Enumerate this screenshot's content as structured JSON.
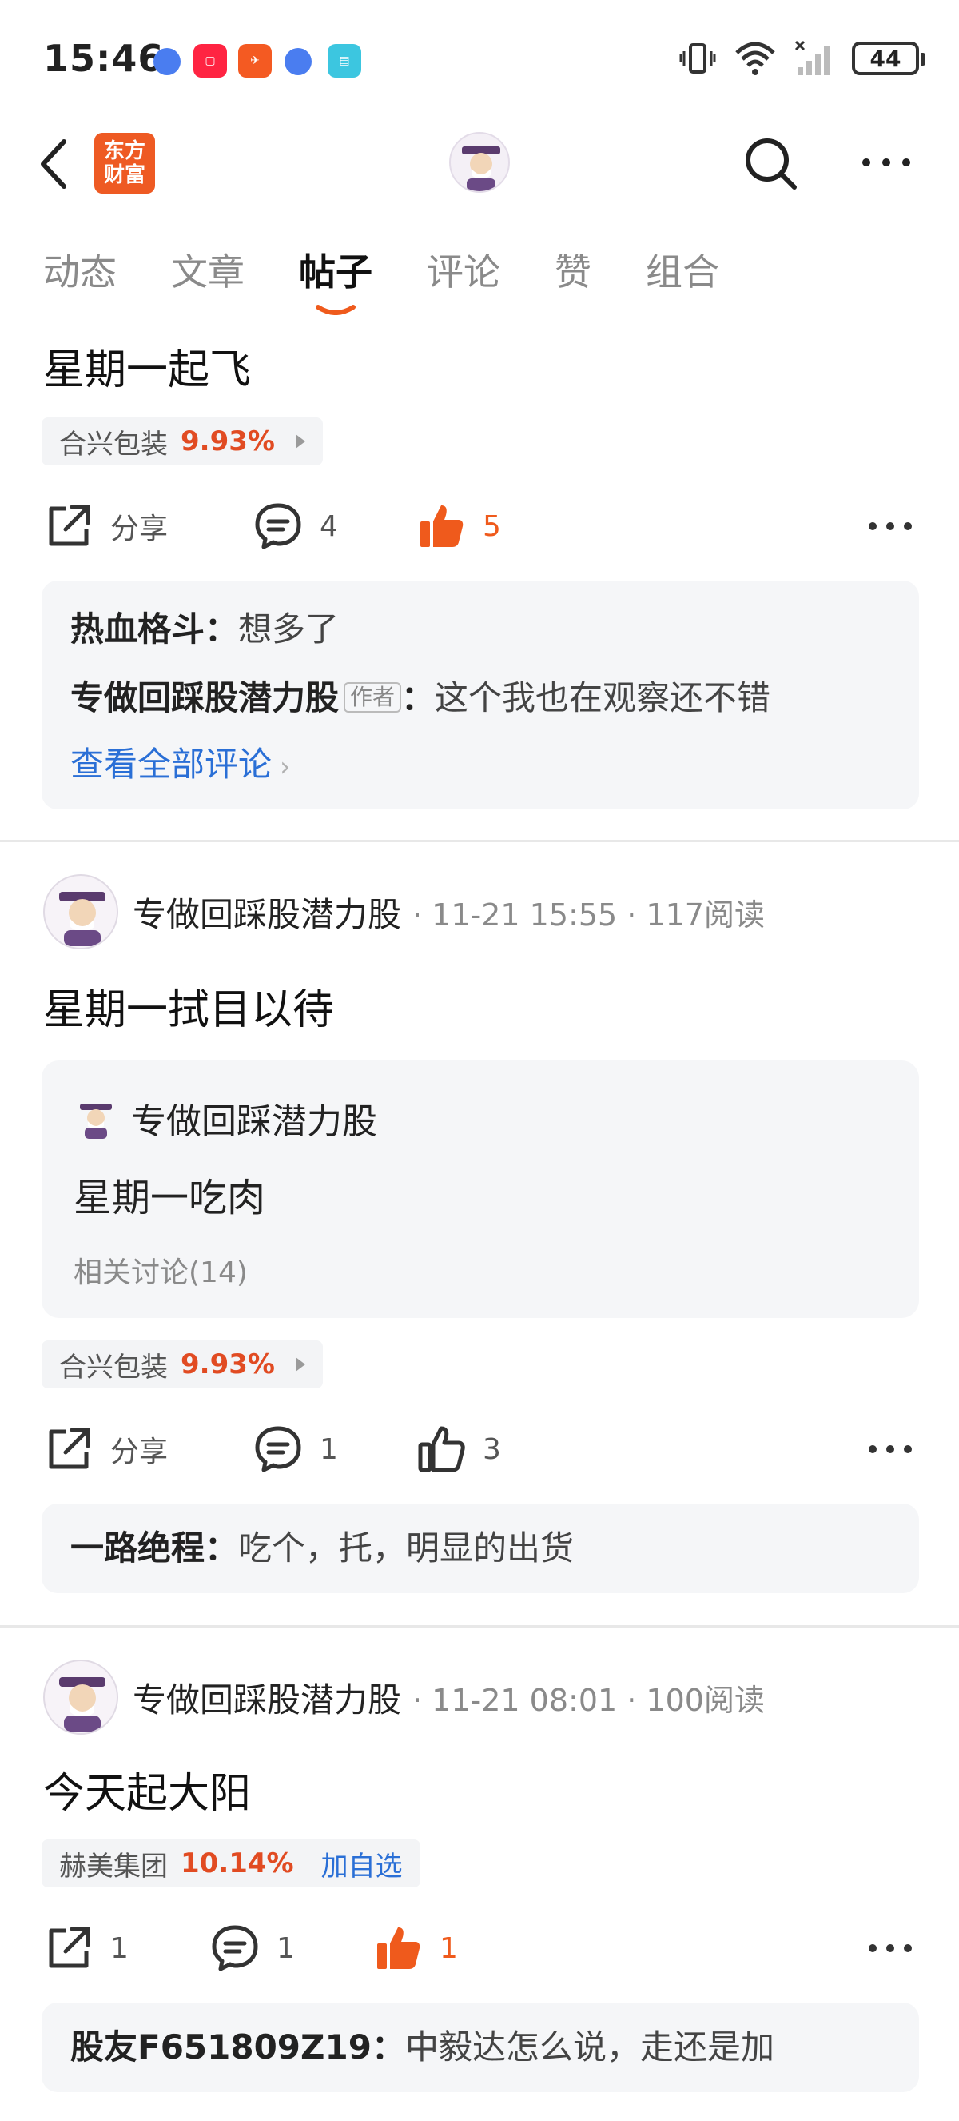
{
  "status_bar": {
    "time": "15:46",
    "battery": "44"
  },
  "header": {
    "brand_line1": "东方",
    "brand_line2": "财富"
  },
  "tabs": [
    {
      "label": "动态"
    },
    {
      "label": "文章"
    },
    {
      "label": "帖子"
    },
    {
      "label": "评论"
    },
    {
      "label": "赞"
    },
    {
      "label": "组合"
    }
  ],
  "active_tab": "帖子",
  "post1": {
    "title": "星期一起飞",
    "stock": {
      "name": "合兴包装",
      "pct": "9.93%"
    },
    "actions": {
      "share": "分享",
      "comments": "4",
      "likes": "5"
    },
    "comments": [
      {
        "user": "热血格斗",
        "sep": "：",
        "text": "想多了"
      },
      {
        "user": "专做回踩股潜力股",
        "tag": "作者",
        "sep": "：",
        "text": "这个我也在观察还不错"
      }
    ],
    "view_all": "查看全部评论"
  },
  "post2": {
    "author": "专做回踩股潜力股",
    "meta": "· 11-21 15:55 · 117阅读",
    "title": "星期一拭目以待",
    "quote": {
      "author": "专做回踩潜力股",
      "text": "星期一吃肉",
      "related": "相关讨论(14)"
    },
    "stock": {
      "name": "合兴包装",
      "pct": "9.93%"
    },
    "actions": {
      "share": "分享",
      "comments": "1",
      "likes": "3"
    },
    "comments": [
      {
        "user": "一路绝程",
        "sep": "：",
        "text": "吃个，托，明显的出货"
      }
    ]
  },
  "post3": {
    "author": "专做回踩股潜力股",
    "meta": "· 11-21 08:01 · 100阅读",
    "title": "今天起大阳",
    "stock": {
      "name": "赫美集团",
      "pct": "10.14%",
      "add": "加自选"
    },
    "actions": {
      "shares": "1",
      "comments": "1",
      "likes": "1"
    },
    "comments": [
      {
        "user": "股友F651809Z19",
        "sep": "：",
        "text": "中毅达怎么说，走还是加"
      }
    ]
  },
  "colors": {
    "accent": "#ef5a1c",
    "link": "#2a6fd6",
    "brand": "#ee5a23",
    "up": "#e14b22"
  },
  "icons": [
    "back-icon",
    "search-icon",
    "more-icon",
    "share-icon",
    "comment-icon",
    "like-icon",
    "like-filled-icon"
  ]
}
